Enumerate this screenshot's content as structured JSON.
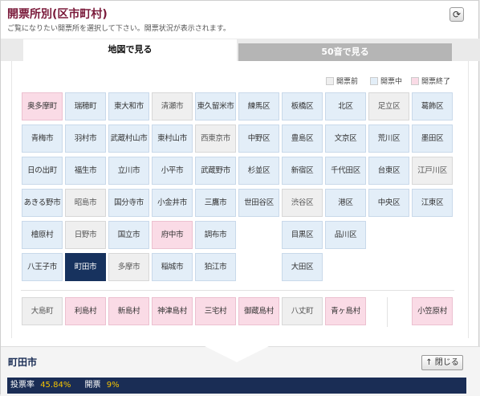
{
  "header": {
    "title": "開票所別(区市町村)",
    "subtitle": "ご覧になりたい開票所を選択して下さい。開票状況が表示されます。"
  },
  "icons": {
    "refresh": "refresh-icon",
    "close": "arrow-up-icon"
  },
  "tabs": [
    {
      "label": "地図で見る",
      "active": true
    },
    {
      "label": "50音で見る",
      "active": false
    }
  ],
  "legend": [
    {
      "label": "開票前",
      "status": "pre"
    },
    {
      "label": "開票中",
      "status": "open"
    },
    {
      "label": "開票終了",
      "status": "closed"
    }
  ],
  "colors": {
    "pre": "#efefef",
    "open": "#e3eef8",
    "closed": "#fadbe6",
    "selected": "#17325e",
    "accent": "#7a1a3a"
  },
  "rows": [
    [
      {
        "name": "奥多摩町",
        "status": "closed"
      },
      {
        "name": "瑞穂町",
        "status": "open"
      },
      {
        "name": "東大和市",
        "status": "open"
      },
      {
        "name": "清瀬市",
        "status": "pre"
      },
      {
        "name": "東久留米市",
        "status": "open"
      },
      {
        "name": "練馬区",
        "status": "open"
      },
      {
        "name": "板橋区",
        "status": "open"
      },
      {
        "name": "北区",
        "status": "open"
      },
      {
        "name": "足立区",
        "status": "pre"
      },
      {
        "name": "葛飾区",
        "status": "open"
      }
    ],
    [
      {
        "name": "青梅市",
        "status": "open"
      },
      {
        "name": "羽村市",
        "status": "open"
      },
      {
        "name": "武蔵村山市",
        "status": "open"
      },
      {
        "name": "東村山市",
        "status": "open"
      },
      {
        "name": "西東京市",
        "status": "pre"
      },
      {
        "name": "中野区",
        "status": "open"
      },
      {
        "name": "豊島区",
        "status": "open"
      },
      {
        "name": "文京区",
        "status": "open"
      },
      {
        "name": "荒川区",
        "status": "open"
      },
      {
        "name": "墨田区",
        "status": "open"
      }
    ],
    [
      {
        "name": "日の出町",
        "status": "open"
      },
      {
        "name": "福生市",
        "status": "open"
      },
      {
        "name": "立川市",
        "status": "open"
      },
      {
        "name": "小平市",
        "status": "open"
      },
      {
        "name": "武蔵野市",
        "status": "open"
      },
      {
        "name": "杉並区",
        "status": "open"
      },
      {
        "name": "新宿区",
        "status": "open"
      },
      {
        "name": "千代田区",
        "status": "open"
      },
      {
        "name": "台東区",
        "status": "open"
      },
      {
        "name": "江戸川区",
        "status": "pre"
      }
    ],
    [
      {
        "name": "あきる野市",
        "status": "open"
      },
      {
        "name": "昭島市",
        "status": "pre"
      },
      {
        "name": "国分寺市",
        "status": "open"
      },
      {
        "name": "小金井市",
        "status": "open"
      },
      {
        "name": "三鷹市",
        "status": "open"
      },
      {
        "name": "世田谷区",
        "status": "open"
      },
      {
        "name": "渋谷区",
        "status": "pre"
      },
      {
        "name": "港区",
        "status": "open"
      },
      {
        "name": "中央区",
        "status": "open"
      },
      {
        "name": "江東区",
        "status": "open"
      }
    ],
    [
      {
        "name": "檜原村",
        "status": "open"
      },
      {
        "name": "日野市",
        "status": "pre"
      },
      {
        "name": "国立市",
        "status": "open"
      },
      {
        "name": "府中市",
        "status": "closed"
      },
      {
        "name": "調布市",
        "status": "open"
      },
      null,
      {
        "name": "目黒区",
        "status": "open"
      },
      {
        "name": "品川区",
        "status": "open"
      },
      null,
      null
    ],
    [
      {
        "name": "八王子市",
        "status": "open"
      },
      {
        "name": "町田市",
        "status": "selected"
      },
      {
        "name": "多摩市",
        "status": "pre"
      },
      {
        "name": "稲城市",
        "status": "open"
      },
      {
        "name": "狛江市",
        "status": "open"
      },
      null,
      {
        "name": "大田区",
        "status": "open"
      },
      null,
      null,
      null
    ]
  ],
  "islands": [
    {
      "name": "大島町",
      "status": "pre"
    },
    {
      "name": "利島村",
      "status": "closed"
    },
    {
      "name": "新島村",
      "status": "closed"
    },
    {
      "name": "神津島村",
      "status": "closed"
    },
    {
      "name": "三宅村",
      "status": "closed"
    },
    {
      "name": "御蔵島村",
      "status": "closed"
    },
    {
      "name": "八丈町",
      "status": "pre"
    },
    {
      "name": "青ヶ島村",
      "status": "closed"
    },
    null,
    {
      "name": "小笠原村",
      "status": "closed"
    }
  ],
  "selected": {
    "name": "町田市",
    "close_label": "閉じる",
    "turnout_label": "投票率",
    "turnout_value": "45.84%",
    "count_label": "開票",
    "count_value": "9%"
  }
}
